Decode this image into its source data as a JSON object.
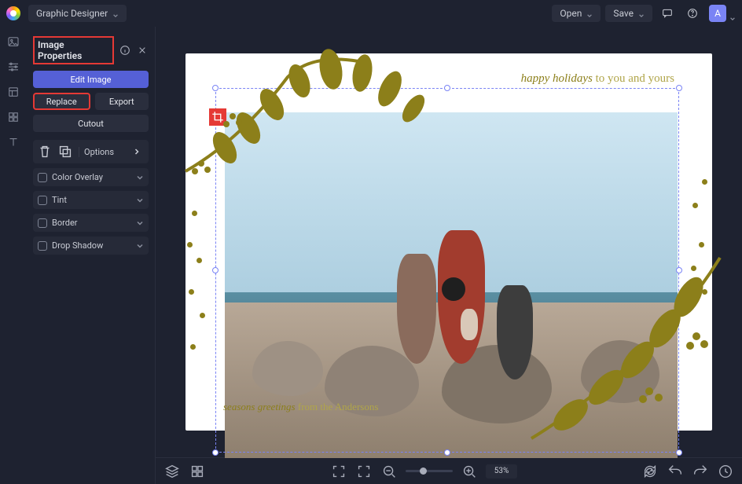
{
  "header": {
    "role": "Graphic Designer",
    "open": "Open",
    "save": "Save",
    "avatar_initial": "A"
  },
  "panel": {
    "title": "Image Properties",
    "edit_image": "Edit Image",
    "replace": "Replace",
    "export": "Export",
    "cutout": "Cutout",
    "options": "Options",
    "acc": [
      "Color Overlay",
      "Tint",
      "Border",
      "Drop Shadow"
    ]
  },
  "card": {
    "head_italic": "happy holidays",
    "head_rest": " to you and yours",
    "foot_italic": "seasons greetings",
    "foot_rest": " from the Andersons"
  },
  "footer": {
    "zoom": "53%"
  }
}
